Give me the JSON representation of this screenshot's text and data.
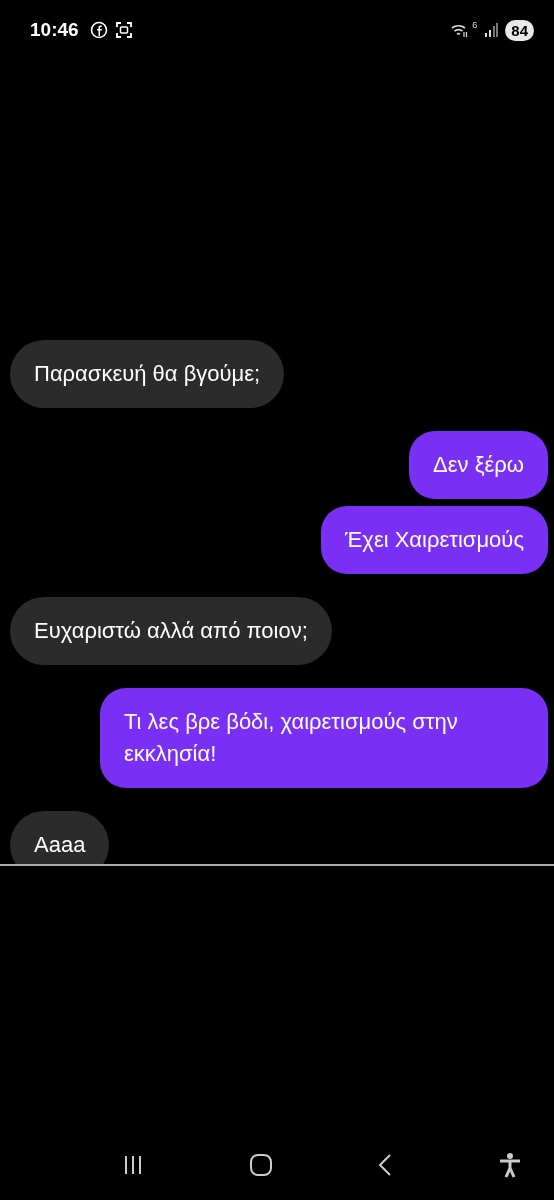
{
  "status_bar": {
    "time": "10:46",
    "wifi_label": "6",
    "battery": "84"
  },
  "messages": [
    {
      "kind": "received",
      "text": "Παρασκευή θα βγούμε;"
    },
    {
      "kind": "sent",
      "text": "Δεν ξέρω"
    },
    {
      "kind": "sent",
      "text": "Έχει Χαιρετισμούς"
    },
    {
      "kind": "received",
      "text": "Ευχαριστώ αλλά από ποιον;"
    },
    {
      "kind": "sent",
      "text": "Τι λες βρε βόδι, χαιρετισμούς στην εκκλησία!"
    },
    {
      "kind": "received",
      "text": "Αaaa"
    }
  ]
}
